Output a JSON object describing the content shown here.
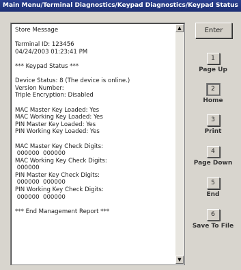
{
  "window": {
    "title": "Main Menu/Terminal Diagnostics/Keypad Diagnostics/Keypad Status"
  },
  "message_lines": [
    "Store Message",
    "",
    "Terminal ID: 123456",
    "04/24/2003 01:23:41 PM",
    "",
    "*** Keypad Status ***",
    "",
    "Device Status: 8 (The device is online.)",
    "Version Number:",
    "Triple Encryption: Disabled",
    "",
    "MAC Master Key Loaded: Yes",
    "MAC Working Key Loaded: Yes",
    "PIN Master Key Loaded: Yes",
    "PIN Working Key Loaded: Yes",
    "",
    "MAC Master Key Check Digits:",
    " 000000  000000",
    "MAC Working Key Check Digits:",
    " 000000",
    "PIN Master Key Check Digits:",
    " 000000  000000",
    "PIN Working Key Check Digits:",
    " 000000  000000",
    "",
    "*** End Management Report ***"
  ],
  "scrollbar": {
    "up_arrow": "▲",
    "down_arrow": "▼"
  },
  "buttons": {
    "enter": "Enter",
    "keys": [
      {
        "key": "1",
        "label": "Page Up"
      },
      {
        "key": "2",
        "label": "Home"
      },
      {
        "key": "3",
        "label": "Print"
      },
      {
        "key": "4",
        "label": "Page Down"
      },
      {
        "key": "5",
        "label": "End"
      },
      {
        "key": "6",
        "label": "Save To File"
      }
    ]
  }
}
